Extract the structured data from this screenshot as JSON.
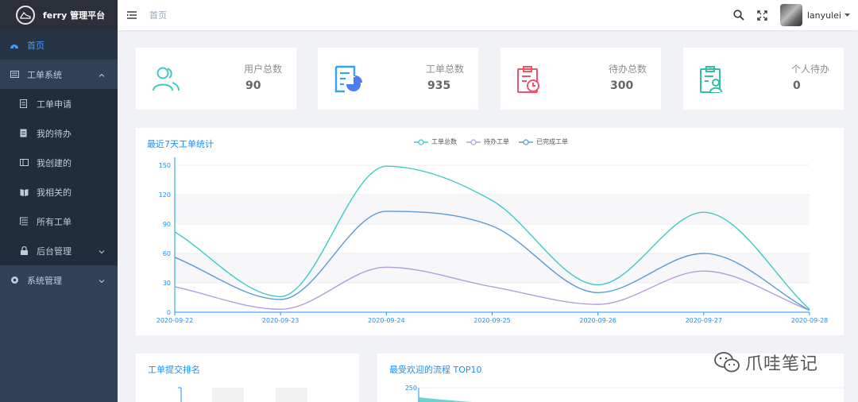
{
  "app": {
    "title": "ferry 管理平台"
  },
  "sidebar": {
    "items": [
      {
        "label": "首页",
        "icon": "dashboard-icon",
        "active": true
      },
      {
        "label": "工单系统",
        "icon": "ticket-system-icon",
        "expanded": true,
        "children": [
          {
            "label": "工单申请",
            "icon": "apply-icon"
          },
          {
            "label": "我的待办",
            "icon": "todo-icon"
          },
          {
            "label": "我创建的",
            "icon": "created-icon"
          },
          {
            "label": "我相关的",
            "icon": "related-icon"
          },
          {
            "label": "所有工单",
            "icon": "all-tickets-icon"
          },
          {
            "label": "后台管理",
            "icon": "lock-icon"
          }
        ]
      },
      {
        "label": "系统管理",
        "icon": "system-icon"
      }
    ]
  },
  "navbar": {
    "breadcrumb": "首页",
    "username": "lanyulei"
  },
  "stats": [
    {
      "label": "用户总数",
      "value": "90",
      "icon": "users-icon",
      "color": "#40c9c6"
    },
    {
      "label": "工单总数",
      "value": "935",
      "icon": "ticket-chart-icon",
      "color": "#36a3f7"
    },
    {
      "label": "待办总数",
      "value": "300",
      "icon": "clipboard-clock-icon",
      "color": "#f4516c"
    },
    {
      "label": "个人待办",
      "value": "0",
      "icon": "clipboard-person-icon",
      "color": "#34bfa3"
    }
  ],
  "chart": {
    "title": "最近7天工单统计"
  },
  "chart_data": {
    "type": "line",
    "x": [
      "2020-09-22",
      "2020-09-23",
      "2020-09-24",
      "2020-09-25",
      "2020-09-26",
      "2020-09-27",
      "2020-09-28"
    ],
    "series": [
      {
        "name": "工单总数",
        "values": [
          82,
          16,
          149,
          114,
          28,
          102,
          3
        ],
        "color": "#40c9c6"
      },
      {
        "name": "待办工单",
        "values": [
          26,
          3,
          46,
          26,
          8,
          42,
          2
        ],
        "color": "#b39ddb"
      },
      {
        "name": "已完成工单",
        "values": [
          56,
          13,
          103,
          88,
          20,
          60,
          2
        ],
        "color": "#5b9bd5"
      }
    ],
    "yticks": [
      0,
      30,
      60,
      90,
      120,
      150
    ],
    "ylim": [
      0,
      150
    ]
  },
  "bottom": {
    "left_title": "工单提交排名",
    "right_title": "最受欢迎的流程 TOP10",
    "right_ytick": "250"
  },
  "watermark": {
    "text": "爪哇笔记"
  }
}
